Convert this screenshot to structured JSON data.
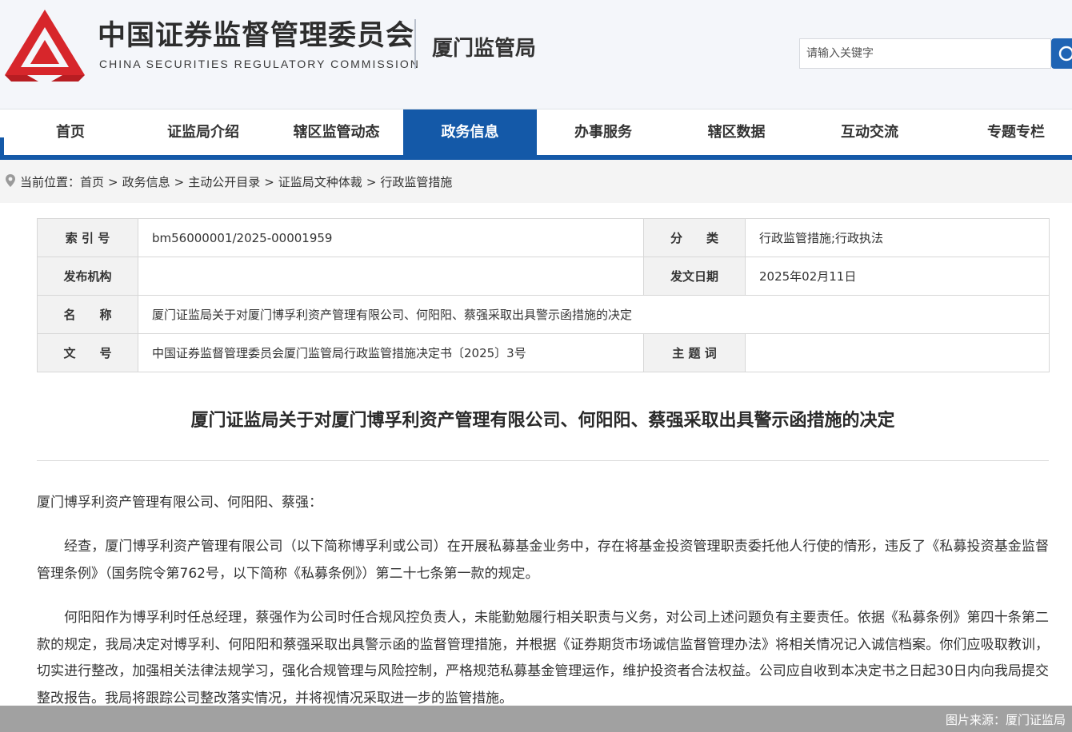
{
  "header": {
    "org_name_cn": "中国证券监督管理委员会",
    "org_name_en": "CHINA SECURITIES REGULATORY COMMISSION",
    "bureau": "厦门监管局",
    "search_placeholder": "请输入关键字",
    "logo_icon": "csrc-logo-icon",
    "brand_color": "#d7262b",
    "accent_color": "#1459a8"
  },
  "nav": {
    "items": [
      {
        "label": "首页"
      },
      {
        "label": "证监局介绍"
      },
      {
        "label": "辖区监管动态"
      },
      {
        "label": "政务信息",
        "active": true
      },
      {
        "label": "办事服务"
      },
      {
        "label": "辖区数据"
      },
      {
        "label": "互动交流"
      },
      {
        "label": "专题专栏"
      }
    ]
  },
  "breadcrumb": {
    "prefix": "当前位置：",
    "items": [
      "首页",
      "政务信息",
      "主动公开目录",
      "证监局文种体裁",
      "行政监管措施"
    ]
  },
  "info": {
    "index_label": "索 引 号",
    "index_value": "bm56000001/2025-00001959",
    "category_label": "分　　类",
    "category_value": "行政监管措施;行政执法",
    "publisher_label": "发布机构",
    "publisher_value": "",
    "date_label": "发文日期",
    "date_value": "2025年02月11日",
    "name_label": "名　　称",
    "name_value": "厦门证监局关于对厦门博孚利资产管理有限公司、何阳阳、蔡强采取出具警示函措施的决定",
    "docno_label": "文　　号",
    "docno_value": "中国证券监督管理委员会厦门监管局行政监管措施决定书〔2025〕3号",
    "keywords_label": "主 题 词",
    "keywords_value": ""
  },
  "article": {
    "title": "厦门证监局关于对厦门博孚利资产管理有限公司、何阳阳、蔡强采取出具警示函措施的决定",
    "salutation": "厦门博孚利资产管理有限公司、何阳阳、蔡强：",
    "paragraph1": "经查，厦门博孚利资产管理有限公司（以下简称博孚利或公司）在开展私募基金业务中，存在将基金投资管理职责委托他人行使的情形，违反了《私募投资基金监督管理条例》（国务院令第762号，以下简称《私募条例》）第二十七条第一款的规定。",
    "paragraph2": "何阳阳作为博孚利时任总经理，蔡强作为公司时任合规风控负责人，未能勤勉履行相关职责与义务，对公司上述问题负有主要责任。依据《私募条例》第四十条第二款的规定，我局决定对博孚利、何阳阳和蔡强采取出具警示函的监督管理措施，并根据《证券期货市场诚信监督管理办法》将相关情况记入诚信档案。你们应吸取教训，切实进行整改，加强相关法律法规学习，强化合规管理与风险控制，严格规范私募基金管理运作，维护投资者合法权益。公司应自收到本决定书之日起30日内向我局提交整改报告。我局将跟踪公司整改落实情况，并将视情况采取进一步的监管措施。"
  },
  "caption": "图片来源：厦门证监局"
}
